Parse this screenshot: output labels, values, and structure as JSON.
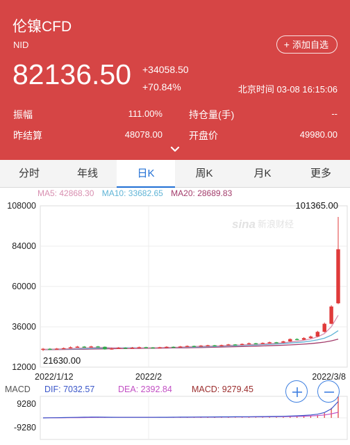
{
  "header": {
    "title": "伦镍CFD",
    "code": "NID",
    "add_button": "添加自选",
    "price": "82136.50",
    "change_abs": "+34058.50",
    "change_pct": "+70.84%",
    "time": "北京时间 03-08 16:15:06",
    "stats": [
      {
        "label": "振幅",
        "value": "111.00%"
      },
      {
        "label": "持仓量(手)",
        "value": "--"
      },
      {
        "label": "昨结算",
        "value": "48078.00"
      },
      {
        "label": "开盘价",
        "value": "49980.00"
      }
    ]
  },
  "tabs": [
    {
      "label": "分时",
      "active": false
    },
    {
      "label": "年线",
      "active": false
    },
    {
      "label": "日K",
      "active": true
    },
    {
      "label": "周K",
      "active": false
    },
    {
      "label": "月K",
      "active": false
    },
    {
      "label": "更多",
      "active": false
    }
  ],
  "ma": {
    "ma5": "MA5: 42868.30",
    "ma10": "MA10: 33682.65",
    "ma20": "MA20: 28689.83"
  },
  "macd": {
    "label": "MACD",
    "dif": "DIF: 7032.57",
    "dea": "DEA: 2392.84",
    "macd": "MACD: 9279.45",
    "y_ticks": [
      "9280",
      "-9280"
    ],
    "y_range": [
      -9280,
      9280
    ]
  },
  "colors": {
    "header_bg": "#d64545",
    "up": "#e03a3a",
    "down": "#2ea84a",
    "ma5": "#d88fb0",
    "ma10": "#5fb4d6",
    "ma20": "#a23b6a",
    "dif": "#3b57c9",
    "dea": "#c24fc4",
    "macd": "#9b2d2d",
    "accent": "#1f6ed4"
  },
  "chart_data": {
    "type": "candlestick",
    "y_ticks": [
      "108000",
      "84000",
      "60000",
      "36000",
      "12000"
    ],
    "ylim": [
      12000,
      108000
    ],
    "x_ticks": [
      "2022/1/12",
      "2022/2",
      "2022/3/8"
    ],
    "max_label": "101365.00",
    "min_label": "21630.00",
    "candles": [
      {
        "o": 22300,
        "c": 22900,
        "h": 23400,
        "l": 21630
      },
      {
        "o": 22900,
        "c": 22700,
        "h": 23300,
        "l": 22300
      },
      {
        "o": 22700,
        "c": 23000,
        "h": 23400,
        "l": 22500
      },
      {
        "o": 23000,
        "c": 23300,
        "h": 23700,
        "l": 22800
      },
      {
        "o": 23300,
        "c": 23800,
        "h": 24300,
        "l": 23100
      },
      {
        "o": 23800,
        "c": 24200,
        "h": 24600,
        "l": 23600
      },
      {
        "o": 24200,
        "c": 23900,
        "h": 24500,
        "l": 23600
      },
      {
        "o": 23900,
        "c": 24300,
        "h": 24700,
        "l": 23700
      },
      {
        "o": 24300,
        "c": 24100,
        "h": 24600,
        "l": 23900
      },
      {
        "o": 24100,
        "c": 22600,
        "h": 24300,
        "l": 22400
      },
      {
        "o": 22600,
        "c": 23100,
        "h": 23500,
        "l": 22400
      },
      {
        "o": 23100,
        "c": 23500,
        "h": 23900,
        "l": 22900
      },
      {
        "o": 23500,
        "c": 23200,
        "h": 23800,
        "l": 23000
      },
      {
        "o": 23200,
        "c": 23600,
        "h": 24000,
        "l": 23000
      },
      {
        "o": 23600,
        "c": 23900,
        "h": 24200,
        "l": 23400
      },
      {
        "o": 23900,
        "c": 23700,
        "h": 24100,
        "l": 23500
      },
      {
        "o": 23700,
        "c": 23400,
        "h": 23900,
        "l": 23200
      },
      {
        "o": 23400,
        "c": 23800,
        "h": 24100,
        "l": 23200
      },
      {
        "o": 23800,
        "c": 24100,
        "h": 24400,
        "l": 23600
      },
      {
        "o": 24100,
        "c": 23900,
        "h": 24300,
        "l": 23700
      },
      {
        "o": 23900,
        "c": 24300,
        "h": 24600,
        "l": 23800
      },
      {
        "o": 24300,
        "c": 24600,
        "h": 24900,
        "l": 24100
      },
      {
        "o": 24600,
        "c": 24400,
        "h": 24800,
        "l": 24200
      },
      {
        "o": 24400,
        "c": 24800,
        "h": 25100,
        "l": 24200
      },
      {
        "o": 24800,
        "c": 25000,
        "h": 25300,
        "l": 24600
      },
      {
        "o": 25000,
        "c": 24700,
        "h": 25200,
        "l": 24500
      },
      {
        "o": 24700,
        "c": 25100,
        "h": 25400,
        "l": 24500
      },
      {
        "o": 25100,
        "c": 25500,
        "h": 25800,
        "l": 24900
      },
      {
        "o": 25500,
        "c": 25300,
        "h": 25700,
        "l": 25100
      },
      {
        "o": 25300,
        "c": 25800,
        "h": 26100,
        "l": 25100
      },
      {
        "o": 25800,
        "c": 26200,
        "h": 26600,
        "l": 25600
      },
      {
        "o": 26200,
        "c": 26000,
        "h": 26400,
        "l": 25800
      },
      {
        "o": 26000,
        "c": 26400,
        "h": 26700,
        "l": 25800
      },
      {
        "o": 26400,
        "c": 26800,
        "h": 27200,
        "l": 26200
      },
      {
        "o": 26800,
        "c": 26600,
        "h": 27000,
        "l": 26300
      },
      {
        "o": 26600,
        "c": 27300,
        "h": 27700,
        "l": 26400
      },
      {
        "o": 27300,
        "c": 28700,
        "h": 29100,
        "l": 27100
      },
      {
        "o": 28700,
        "c": 28300,
        "h": 29200,
        "l": 28000
      },
      {
        "o": 28300,
        "c": 29300,
        "h": 29800,
        "l": 28100
      },
      {
        "o": 29300,
        "c": 30200,
        "h": 30700,
        "l": 29000
      },
      {
        "o": 30200,
        "c": 33000,
        "h": 33600,
        "l": 30000
      },
      {
        "o": 33000,
        "c": 37800,
        "h": 38500,
        "l": 32600
      },
      {
        "o": 37800,
        "c": 48078,
        "h": 48800,
        "l": 37500
      },
      {
        "o": 49980,
        "c": 82136.5,
        "h": 101365,
        "l": 49500
      }
    ],
    "ma5": [
      22600,
      22700,
      22800,
      22900,
      23000,
      23200,
      23400,
      23600,
      23800,
      23700,
      23500,
      23400,
      23300,
      23300,
      23400,
      23500,
      23600,
      23600,
      23700,
      23800,
      23900,
      24100,
      24300,
      24400,
      24500,
      24600,
      24700,
      24900,
      25100,
      25200,
      25400,
      25600,
      25800,
      26000,
      26200,
      26500,
      27000,
      27400,
      28000,
      28800,
      30000,
      32000,
      36000,
      42868.3
    ],
    "ma10": [
      22500,
      22550,
      22600,
      22700,
      22800,
      22900,
      23000,
      23150,
      23300,
      23350,
      23400,
      23450,
      23500,
      23500,
      23500,
      23550,
      23550,
      23600,
      23650,
      23700,
      23750,
      23850,
      23950,
      24050,
      24150,
      24300,
      24450,
      24600,
      24750,
      24900,
      25050,
      25200,
      25400,
      25600,
      25800,
      26000,
      26300,
      26600,
      27000,
      27500,
      28200,
      29200,
      31000,
      33682.65
    ],
    "ma20": [
      22400,
      22420,
      22450,
      22500,
      22550,
      22600,
      22680,
      22760,
      22850,
      22900,
      22950,
      23000,
      23050,
      23100,
      23150,
      23200,
      23250,
      23300,
      23350,
      23400,
      23450,
      23520,
      23600,
      23680,
      23760,
      23850,
      23950,
      24050,
      24150,
      24250,
      24370,
      24500,
      24630,
      24760,
      24900,
      25050,
      25250,
      25450,
      25700,
      26000,
      26400,
      26900,
      27600,
      28689.83
    ],
    "dif": [
      0,
      50,
      100,
      150,
      200,
      250,
      300,
      320,
      340,
      300,
      260,
      240,
      230,
      230,
      240,
      250,
      250,
      260,
      280,
      300,
      320,
      340,
      360,
      380,
      400,
      420,
      440,
      460,
      480,
      500,
      520,
      540,
      560,
      600,
      640,
      700,
      800,
      900,
      1050,
      1250,
      1600,
      2300,
      3900,
      7032.57
    ],
    "dea": [
      0,
      20,
      40,
      60,
      90,
      120,
      150,
      180,
      210,
      220,
      225,
      225,
      225,
      225,
      228,
      230,
      232,
      236,
      245,
      255,
      265,
      280,
      295,
      310,
      325,
      340,
      355,
      370,
      385,
      400,
      420,
      440,
      460,
      480,
      510,
      540,
      590,
      650,
      730,
      830,
      980,
      1250,
      1750,
      2392.84
    ],
    "macd": [
      0,
      60,
      120,
      180,
      220,
      260,
      300,
      280,
      260,
      160,
      70,
      30,
      10,
      10,
      24,
      40,
      36,
      48,
      70,
      90,
      110,
      120,
      130,
      140,
      150,
      160,
      170,
      180,
      190,
      200,
      200,
      200,
      200,
      240,
      260,
      320,
      420,
      500,
      640,
      840,
      1240,
      2100,
      4300,
      9279.45
    ]
  }
}
